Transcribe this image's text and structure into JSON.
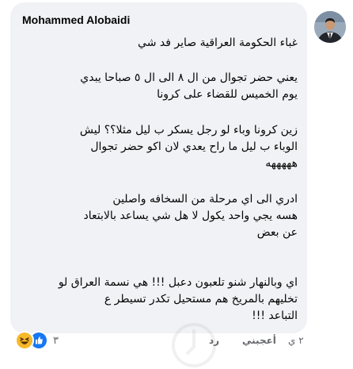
{
  "comment": {
    "author": "Mohammed Alobaidi",
    "paragraphs": [
      [
        "غباء الحكومة العراقية صاير فد شي"
      ],
      [
        "يعني حضر تجوال من ال ٨ الى ال ٥ صباحا يبدي",
        "يوم الخميس للقضاء على كرونا"
      ],
      [
        "زين كرونا وباء لو رجل يسكر ب ليل  مثلا؟؟ ليش",
        "الوباء ب ليل ما راح يعدي لان اكو حضر تجوال",
        "هههههه"
      ],
      [
        "ادري الى اي مرحلة من السخافه واصلين",
        "هسه يجي واحد يكول لا  هل شي يساعد بالابتعاد",
        "عن بعض"
      ],
      [
        "اي وبالنهار شنو تلعبون دعبل !!! هي نسمة العراق لو",
        "تخليهم بالمريخ هم مستحيل تكدر تسيطر ع",
        "التباعد !!!"
      ]
    ]
  },
  "footer": {
    "time": "٢ ي",
    "like": "أعجبني",
    "reply": "رد",
    "reaction_count": "٣"
  },
  "reactions": [
    "haha-icon",
    "like-icon"
  ]
}
